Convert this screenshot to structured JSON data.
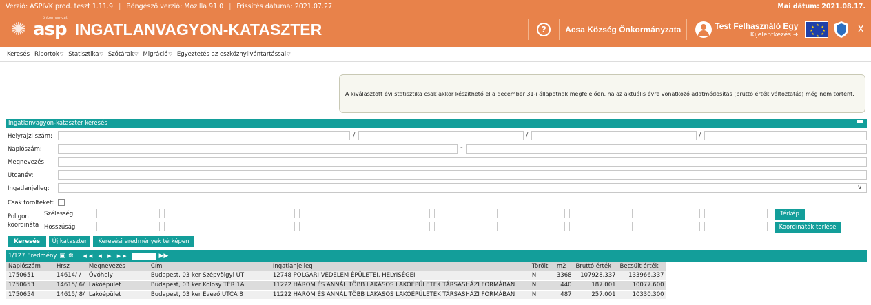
{
  "infobar": {
    "version": "Verzió: ASPIVK prod. teszt 1.11.9",
    "browser": "Böngésző verzió:  Mozilla 91.0",
    "update": "Frissítés dátuma: 2021.07.27",
    "date": "Mai dátum: 2021.08.17."
  },
  "header": {
    "logo_small": "önkormányzati",
    "logo": "asp",
    "title": "INGATLANVAGYON-KATASZTER",
    "help": "?",
    "municipality": "Acsa Község Önkormányzata",
    "user": "Test Felhasználó Egy",
    "logout": "Kijelentkezés ➜",
    "close": "X"
  },
  "menu": {
    "items": [
      {
        "label": "Keresés",
        "dropdown": false
      },
      {
        "label": "Riportok",
        "dropdown": true
      },
      {
        "label": "Statisztika",
        "dropdown": true
      },
      {
        "label": "Szótárak",
        "dropdown": true
      },
      {
        "label": "Migráció",
        "dropdown": true
      },
      {
        "label": "Egyeztetés az eszköznyilvántartással",
        "dropdown": true
      }
    ]
  },
  "notice": "A kiválasztott évi statisztika csak akkor készíthető el a december 31-i állapotnak megfelelően, ha az aktuális évre vonatkozó adatmódosítás (bruttó érték változtatás) még nem történt.",
  "search": {
    "panel_title": "Ingatlanvagyon-kataszter keresés",
    "labels": {
      "hrsz": "Helyrajzi szám:",
      "naplo": "Naplószám:",
      "megnev": "Megnevezés:",
      "utca": "Utcanév:",
      "jelleg": "Ingatlanjelleg:",
      "torolt": "Csak törölteket:",
      "poligon1": "Poligon",
      "poligon2": "koordináta",
      "szel": "Szélesség",
      "hossz": "Hosszúság"
    },
    "buttons": {
      "search": "Keresés",
      "new": "Új kataszter",
      "map_results": "Keresési eredmények térképen",
      "map": "Térkép",
      "clear": "Koordináták törlése"
    }
  },
  "results": {
    "count": "1/127  Eredmény",
    "columns": [
      "Naplószám",
      "Hrsz",
      "Megnevezés",
      "Cím",
      "Ingatlanjelleg",
      "Törölt",
      "m2",
      "Bruttó érték",
      "Becsült érték"
    ],
    "rows": [
      [
        "1750651",
        "14614/ /",
        "Óvóhely",
        "Budapest, 03 ker Szépvölgyi ÚT",
        "12748 POLGÁRI VÉDELEM ÉPÜLETEI, HELYISÉGEI",
        "N",
        "3368",
        "107928.337",
        "133966.337"
      ],
      [
        "1750653",
        "14615/ 6/",
        "Lakóépület",
        "Budapest, 03 ker Kolosy TÉR 1A",
        "11222 HÁROM ÉS ANNÁL TÖBB LAKÁSOS LAKÓÉPÜLETEK TÁRSASHÁZI FORMÁBAN",
        "N",
        "440",
        "187.001",
        "10077.600"
      ],
      [
        "1750654",
        "14615/ 8/",
        "Lakóépület",
        "Budapest, 03 ker Evező UTCA 8",
        "11222 HÁROM ÉS ANNÁL TÖBB LAKÁSOS LAKÓÉPÜLETEK TÁRSASHÁZI FORMÁBAN",
        "N",
        "487",
        "257.001",
        "10330.300"
      ]
    ]
  }
}
